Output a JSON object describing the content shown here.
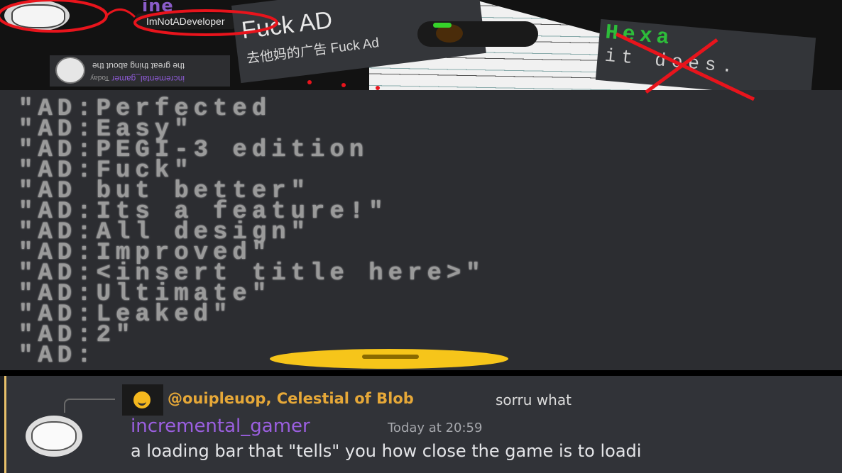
{
  "top": {
    "username_partial": "ine",
    "tooltip": "ImNotADeveloper",
    "flipped_message": {
      "text": "the great thing about the",
      "author": "incremental_gamer",
      "time": "Today"
    }
  },
  "fuck_panel": {
    "title": "Fuck AD",
    "subtitle": "去他妈的广告 Fuck Ad"
  },
  "hexa_panel": {
    "line1": "Hexa",
    "line2": "it does."
  },
  "list": [
    "\"AD:Perfected",
    "\"AD:Easy\"",
    "\"AD:PEGI-3 edition",
    "\"AD:Fuck\"",
    "\"AD but better\"",
    "\"AD:Its a feature!\"",
    "\"AD:All design\"",
    "\"AD:Improved\"",
    "\"AD:<insert title here>\"",
    "\"AD:Ultimate\"",
    "\"AD:Leaked\"",
    "\"AD:2\"",
    "\"AD:"
  ],
  "chat": {
    "reply_mention": "@ouipleuop, Celestial of Blob",
    "reply_text": "sorru what",
    "author": "incremental_gamer",
    "timestamp": "Today at 20:59",
    "message": "a loading bar that \"tells\" you how close the game is to loadi"
  },
  "colors": {
    "annotation_red": "#e8141c",
    "username_purple": "#9b5fe0",
    "mention_orange": "#e6a838",
    "reply_bar": "#e8c06a",
    "dark_bg": "#2c2d31"
  },
  "icons": {
    "avatar": "trollface-avatar",
    "reply_avatar": "yellow-face-avatar"
  }
}
